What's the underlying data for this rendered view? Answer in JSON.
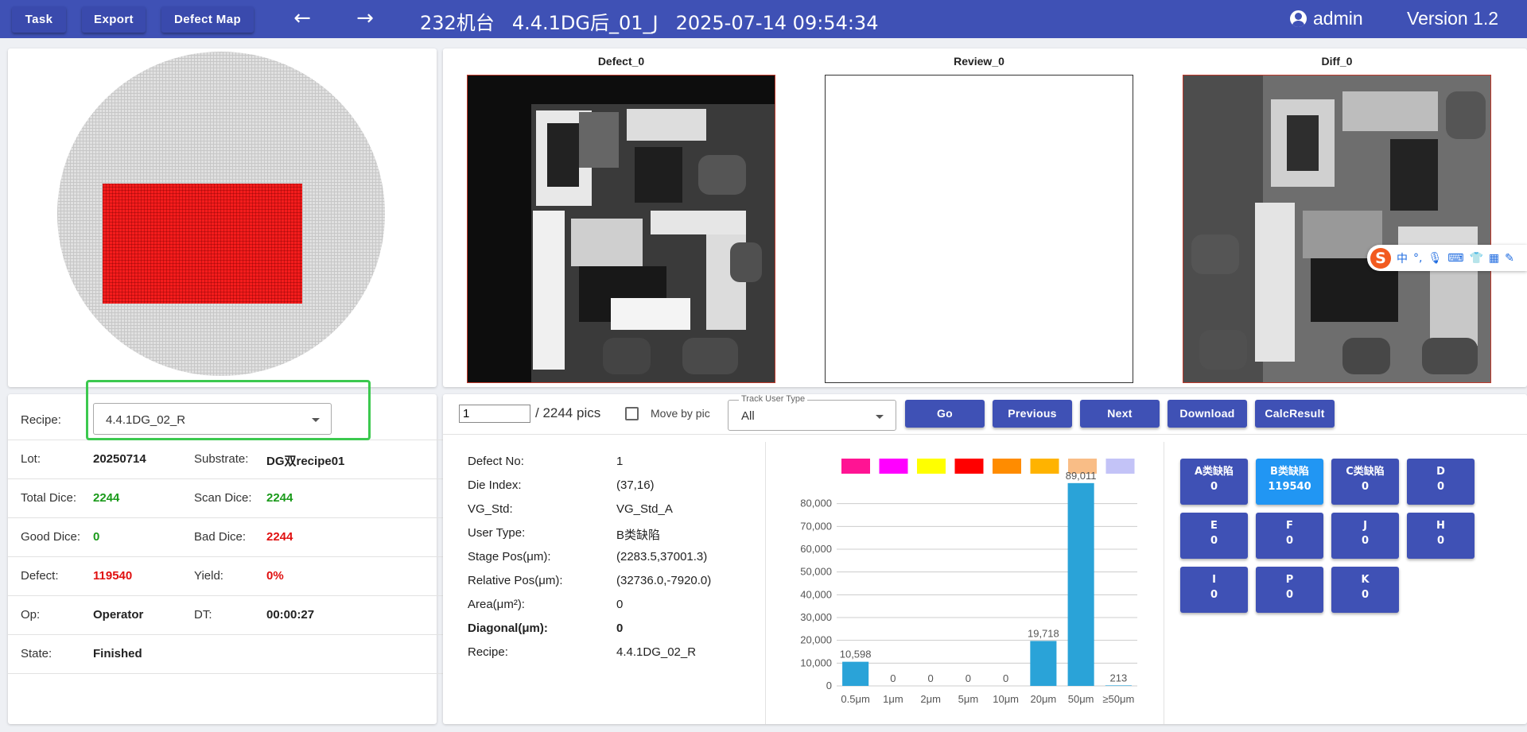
{
  "header": {
    "task_label": "Task",
    "export_label": "Export",
    "defect_map_label": "Defect Map",
    "title_machine": "232机台",
    "title_recipe": "4.4.1DG后_01_J",
    "title_datetime": "2025-07-14 09:54:34",
    "user": "admin",
    "version": "Version 1.2"
  },
  "images": {
    "defect_title": "Defect_0",
    "review_title": "Review_0",
    "diff_title": "Diff_0"
  },
  "info": {
    "recipe_label": "Recipe:",
    "recipe_value": "4.4.1DG_02_R",
    "lot_label": "Lot:",
    "lot_value": "20250714",
    "substrate_label": "Substrate:",
    "substrate_value": "DG双recipe01",
    "total_dice_label": "Total Dice:",
    "total_dice_value": "2244",
    "scan_dice_label": "Scan Dice:",
    "scan_dice_value": "2244",
    "good_dice_label": "Good Dice:",
    "good_dice_value": "0",
    "bad_dice_label": "Bad Dice:",
    "bad_dice_value": "2244",
    "defect_label": "Defect:",
    "defect_value": "119540",
    "yield_label": "Yield:",
    "yield_value": "0%",
    "op_label": "Op:",
    "op_value": "Operator",
    "dt_label": "DT:",
    "dt_value": "00:00:27",
    "state_label": "State:",
    "state_value": "Finished"
  },
  "controls": {
    "page_value": "1",
    "pics_text": "/ 2244 pics",
    "move_by_pic": "Move by pic",
    "track_legend": "Track User Type",
    "track_value": "All",
    "go": "Go",
    "previous": "Previous",
    "next": "Next",
    "download": "Download",
    "calc_result": "CalcResult"
  },
  "details": [
    {
      "label": "Defect No:",
      "value": "1",
      "bold": false
    },
    {
      "label": "Die Index:",
      "value": "(37,16)",
      "bold": false
    },
    {
      "label": "VG_Std:",
      "value": "VG_Std_A",
      "bold": false
    },
    {
      "label": "User Type:",
      "value": "B类缺陷",
      "bold": false
    },
    {
      "label": "Stage Pos(μm):",
      "value": "(2283.5,37001.3)",
      "bold": false
    },
    {
      "label": "Relative Pos(μm):",
      "value": "(32736.0,-7920.0)",
      "bold": false
    },
    {
      "label": "Area(μm²):",
      "value": "0",
      "bold": false
    },
    {
      "label": "Diagonal(μm):",
      "value": "0",
      "bold": true
    },
    {
      "label": "Recipe:",
      "value": "4.4.1DG_02_R",
      "bold": false
    }
  ],
  "chart_data": {
    "type": "bar",
    "categories": [
      "0.5μm",
      "1μm",
      "2μm",
      "5μm",
      "10μm",
      "20μm",
      "50μm",
      "≥50μm"
    ],
    "values": [
      10598,
      0,
      0,
      0,
      0,
      19718,
      89011,
      213
    ],
    "value_labels": [
      "10,598",
      "0",
      "0",
      "0",
      "0",
      "19,718",
      "89,011",
      "213"
    ],
    "y_ticks": [
      "0",
      "10,000",
      "20,000",
      "30,000",
      "40,000",
      "50,000",
      "60,000",
      "70,000",
      "80,000"
    ],
    "ylim": [
      0,
      90000
    ],
    "grid": true,
    "bar_color": "#2aa3d8",
    "legend_colors": [
      "#ff1493",
      "#ff00ff",
      "#ffff00",
      "#ff0000",
      "#ff8c00",
      "#ffb300",
      "#f9bd86",
      "#c3c3f7"
    ]
  },
  "categories": [
    {
      "name": "A类缺陷",
      "count": "0",
      "active": false
    },
    {
      "name": "B类缺陷",
      "count": "119540",
      "active": true
    },
    {
      "name": "C类缺陷",
      "count": "0",
      "active": false
    },
    {
      "name": "D",
      "count": "0",
      "active": false
    },
    {
      "name": "E",
      "count": "0",
      "active": false
    },
    {
      "name": "F",
      "count": "0",
      "active": false
    },
    {
      "name": "J",
      "count": "0",
      "active": false
    },
    {
      "name": "H",
      "count": "0",
      "active": false
    },
    {
      "name": "I",
      "count": "0",
      "active": false
    },
    {
      "name": "P",
      "count": "0",
      "active": false
    },
    {
      "name": "K",
      "count": "0",
      "active": false
    }
  ],
  "ime": {
    "logo": "S",
    "mode": "中"
  }
}
